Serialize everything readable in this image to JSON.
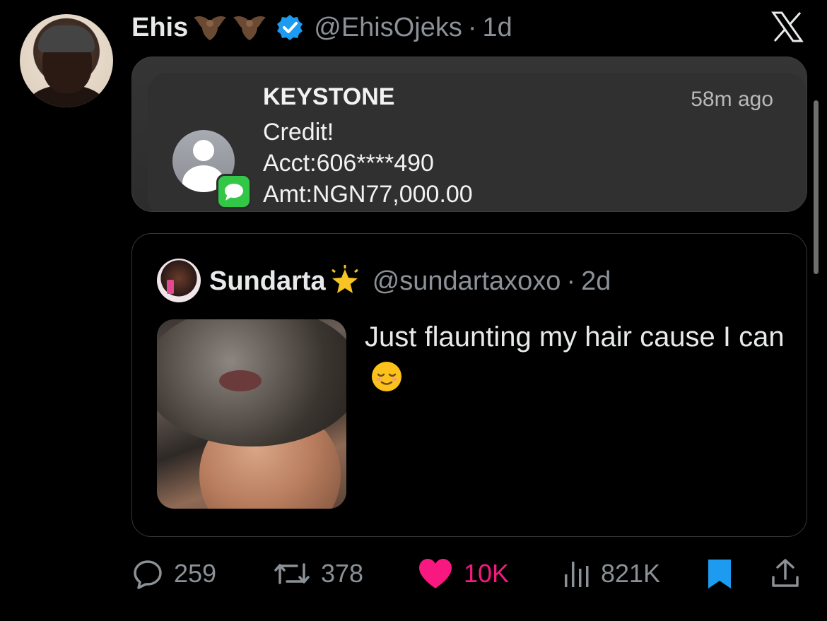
{
  "tweet": {
    "author_name": "Ehis",
    "author_handle": "@EhisOjeks",
    "time": "1d",
    "name_emojis": [
      "bat-emoji",
      "bat-emoji"
    ]
  },
  "notification": {
    "sender": "KEYSTONE",
    "time": "58m ago",
    "lines": [
      "Credit!",
      "Acct:606****490",
      "Amt:NGN77,000.00"
    ],
    "icon": "contact-icon",
    "badge_icon": "messages-icon"
  },
  "quoted_tweet": {
    "author_name": "Sundarta",
    "author_handle": "@sundartaxoxo",
    "time": "2d",
    "name_emoji": "glowing-star-emoji",
    "text": "Just flaunting my hair cause I can",
    "text_emoji": "relieved-face-emoji"
  },
  "actions": {
    "replies": "259",
    "reposts": "378",
    "likes": "10K",
    "views": "821K"
  },
  "colors": {
    "like": "#f91880",
    "bookmark": "#1d9bf0",
    "verified": "#1d9bf0",
    "muted": "#8b9196"
  }
}
